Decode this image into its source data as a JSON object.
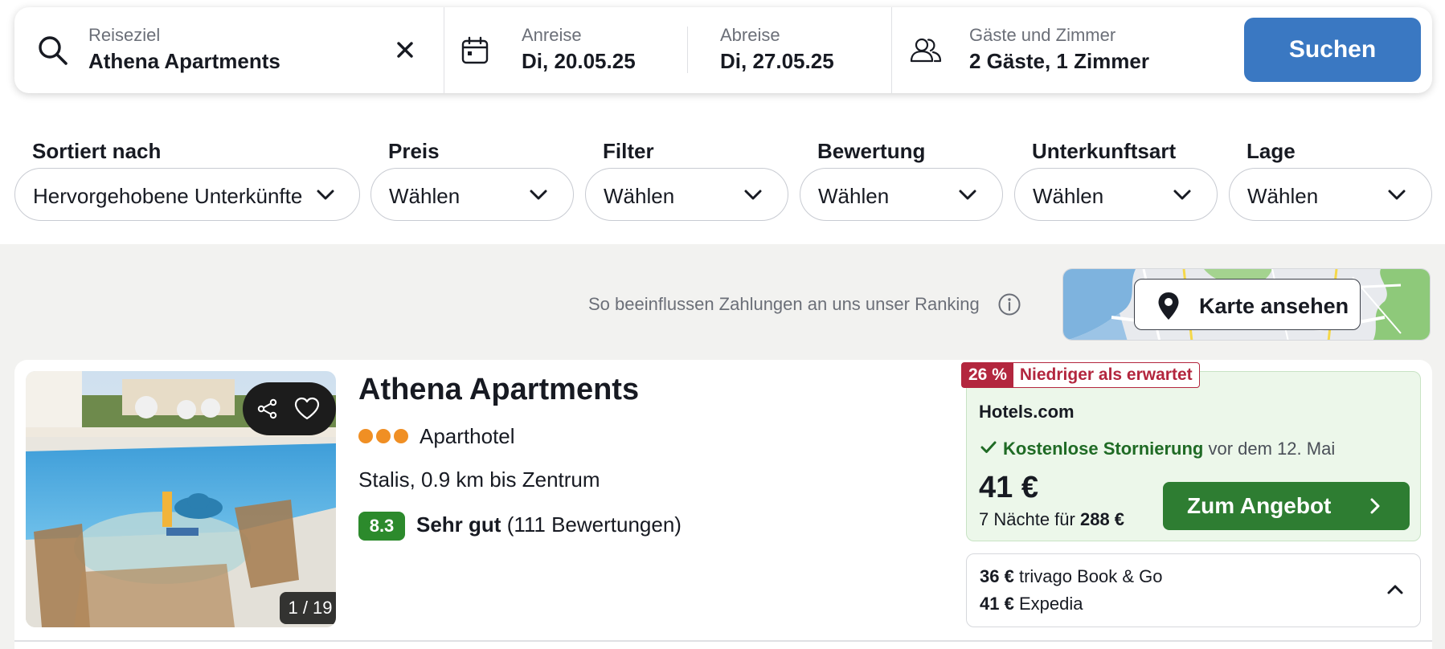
{
  "search": {
    "destination_label": "Reiseziel",
    "destination_value": "Athena Apartments",
    "checkin_label": "Anreise",
    "checkin_value": "Di, 20.05.25",
    "checkout_label": "Abreise",
    "checkout_value": "Di, 27.05.25",
    "guests_label": "Gäste und Zimmer",
    "guests_value": "2 Gäste, 1 Zimmer",
    "search_button": "Suchen",
    "icons": [
      "search-icon",
      "clear-icon",
      "calendar-icon",
      "guests-icon"
    ]
  },
  "filters": [
    {
      "label": "Sortiert nach",
      "value": "Hervorgehobene Unterkünfte"
    },
    {
      "label": "Preis",
      "value": "Wählen"
    },
    {
      "label": "Filter",
      "value": "Wählen"
    },
    {
      "label": "Bewertung",
      "value": "Wählen"
    },
    {
      "label": "Unterkunftsart",
      "value": "Wählen"
    },
    {
      "label": "Lage",
      "value": "Wählen"
    }
  ],
  "ranking_note": "So beeinflussen Zahlungen an uns unser Ranking",
  "map_button": "Karte ansehen",
  "hotel": {
    "name": "Athena Apartments",
    "stars": 3,
    "type": "Aparthotel",
    "location": "Stalis, 0.9 km bis Zentrum",
    "rating_score": "8.3",
    "rating_label": "Sehr gut",
    "rating_count": "(111 Bewertungen)",
    "photo_counter": "1 / 19",
    "deal": {
      "discount_pct": "26 %",
      "discount_text": "Niedriger als erwartet",
      "provider": "Hotels.com",
      "cancellation_strong": "Kostenlose Stornierung",
      "cancellation_rest": "vor dem 12. Mai",
      "price": "41 €",
      "nights_text": "7 Nächte für",
      "nights_total": "288 €",
      "button": "Zum Angebot"
    },
    "alternatives": [
      {
        "price": "36 €",
        "provider": "trivago Book & Go"
      },
      {
        "price": "41 €",
        "provider": "Expedia"
      }
    ]
  },
  "colors": {
    "primary_blue": "#3a78c2",
    "deal_green": "#2e7d32",
    "rating_green": "#2c8a2c",
    "discount_red": "#b3263e",
    "star_orange": "#f08f24"
  }
}
